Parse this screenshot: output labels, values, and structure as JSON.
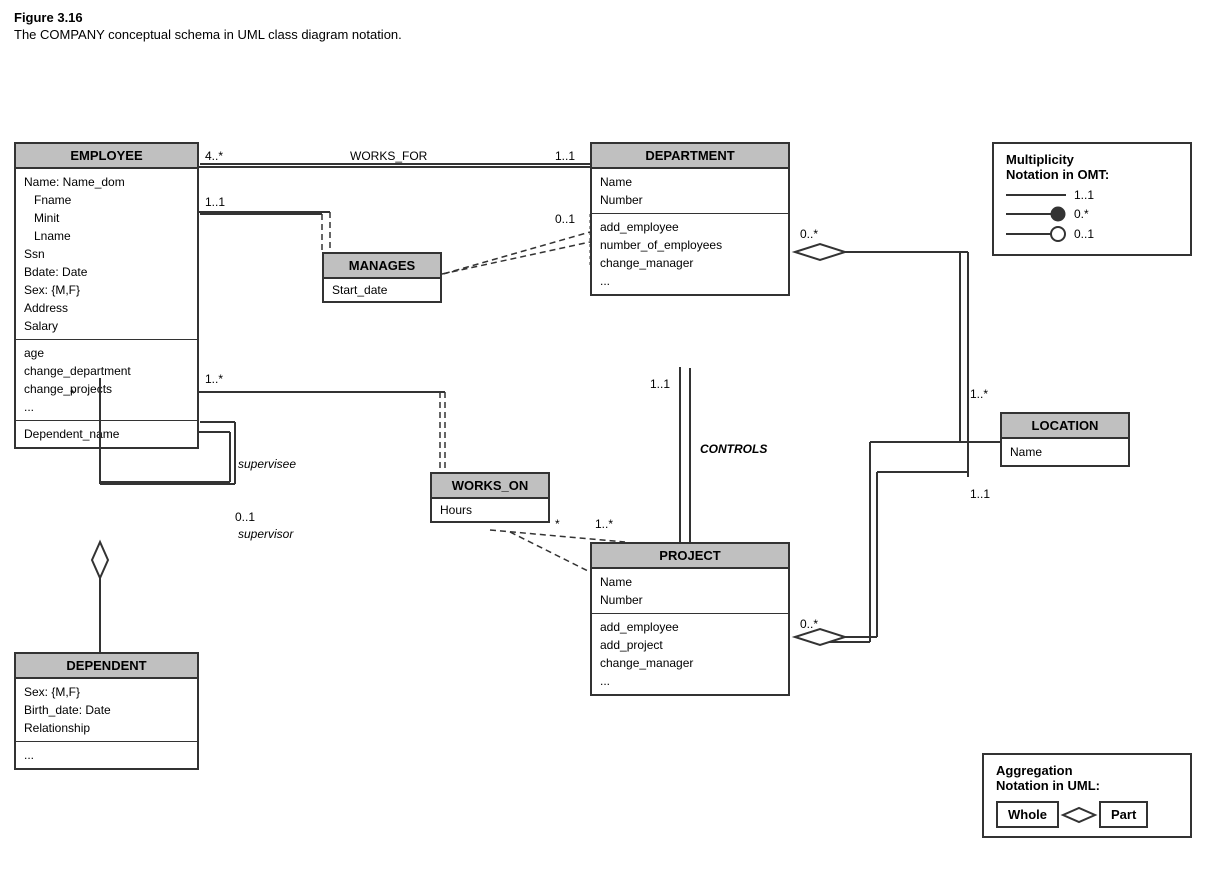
{
  "figure": {
    "title": "Figure 3.16",
    "caption": "The COMPANY conceptual schema in UML class diagram notation."
  },
  "classes": {
    "employee": {
      "header": "EMPLOYEE",
      "section1": [
        "Name: Name_dom",
        "    Fname",
        "    Minit",
        "    Lname",
        "Ssn",
        "Bdate: Date",
        "Sex: {M,F}",
        "Address",
        "Salary"
      ],
      "section2": [
        "age",
        "change_department",
        "change_projects",
        "..."
      ],
      "section3": [
        "Dependent_name"
      ]
    },
    "department": {
      "header": "DEPARTMENT",
      "section1": [
        "Name",
        "Number"
      ],
      "section2": [
        "add_employee",
        "number_of_employees",
        "change_manager",
        "..."
      ]
    },
    "project": {
      "header": "PROJECT",
      "section1": [
        "Name",
        "Number"
      ],
      "section2": [
        "add_employee",
        "add_project",
        "change_manager",
        "..."
      ]
    },
    "location": {
      "header": "LOCATION",
      "section1": [
        "Name"
      ]
    },
    "dependent": {
      "header": "DEPENDENT",
      "section1": [
        "Sex: {M,F}",
        "Birth_date: Date",
        "Relationship"
      ],
      "section2": [
        "..."
      ]
    }
  },
  "assoc": {
    "manages": {
      "header": "MANAGES",
      "body": "Start_date"
    },
    "works_on": {
      "header": "WORKS_ON",
      "body": "Hours"
    }
  },
  "relationships": {
    "works_for": "WORKS_FOR",
    "controls": "CONTROLS"
  },
  "multiplicities": {
    "works_for_emp": "4..*",
    "works_for_dep": "1..1",
    "manages_emp": "1..1",
    "manages_dep": "0..1",
    "supervisee": "*",
    "supervisee_label": "supervisee",
    "supervisor_mult": "0..1",
    "supervisor_label": "supervisor",
    "works_on_emp": "1..*",
    "works_on_proj": "*",
    "controls_dep": "1..1",
    "controls_proj": "1..*",
    "dept_location": "0..*",
    "location_mult": "1..*",
    "location_proj": "1..1",
    "proj_location": "0..*"
  },
  "notation_multiplicity": {
    "title1": "Multiplicity",
    "title2": "Notation in OMT:",
    "rows": [
      {
        "label": "1..1"
      },
      {
        "label": "0.*"
      },
      {
        "label": "0..1"
      }
    ]
  },
  "notation_aggregation": {
    "title1": "Aggregation",
    "title2": "Notation in UML:",
    "whole": "Whole",
    "part": "Part"
  }
}
